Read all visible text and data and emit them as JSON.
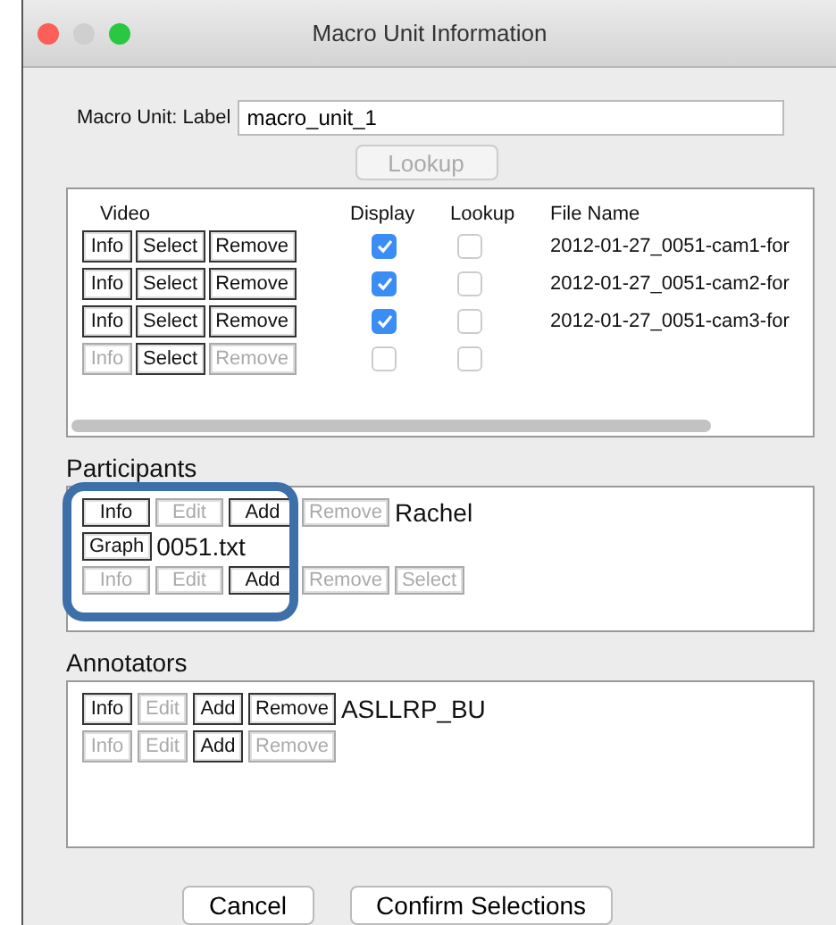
{
  "window": {
    "title": "Macro Unit Information"
  },
  "label_field": {
    "label": "Macro Unit: Label",
    "value": "macro_unit_1"
  },
  "lookup_button": {
    "label": "Lookup",
    "disabled": true
  },
  "video": {
    "columns": [
      "Video",
      "Display",
      "Lookup",
      "File Name"
    ],
    "rows": [
      {
        "buttons": [
          {
            "label": "Info",
            "disabled": false
          },
          {
            "label": "Select",
            "disabled": false
          },
          {
            "label": "Remove",
            "disabled": false
          }
        ],
        "display": {
          "checked": true
        },
        "lookup": {
          "checked": false
        },
        "file_name": "2012-01-27_0051-cam1-for"
      },
      {
        "buttons": [
          {
            "label": "Info",
            "disabled": false
          },
          {
            "label": "Select",
            "disabled": false
          },
          {
            "label": "Remove",
            "disabled": false
          }
        ],
        "display": {
          "checked": true
        },
        "lookup": {
          "checked": false
        },
        "file_name": "2012-01-27_0051-cam2-for"
      },
      {
        "buttons": [
          {
            "label": "Info",
            "disabled": false
          },
          {
            "label": "Select",
            "disabled": false
          },
          {
            "label": "Remove",
            "disabled": false
          }
        ],
        "display": {
          "checked": true
        },
        "lookup": {
          "checked": false
        },
        "file_name": "2012-01-27_0051-cam3-for"
      },
      {
        "buttons": [
          {
            "label": "Info",
            "disabled": true
          },
          {
            "label": "Select",
            "disabled": false
          },
          {
            "label": "Remove",
            "disabled": true
          }
        ],
        "display": {
          "checked": false
        },
        "lookup": {
          "checked": false
        }
      }
    ]
  },
  "participants": {
    "title": "Participants",
    "rows": [
      {
        "items": [
          {
            "kind": "button",
            "label": "Info",
            "disabled": false
          },
          {
            "kind": "button",
            "label": "Edit",
            "disabled": true
          },
          {
            "kind": "button",
            "label": "Add",
            "disabled": false
          },
          {
            "kind": "button",
            "label": "Remove",
            "disabled": true
          },
          {
            "kind": "text",
            "label": "Rachel"
          }
        ]
      },
      {
        "items": [
          {
            "kind": "button",
            "label": "Graph",
            "disabled": false
          },
          {
            "kind": "text",
            "label": "0051.txt"
          }
        ]
      },
      {
        "items": [
          {
            "kind": "button",
            "label": "Info",
            "disabled": true
          },
          {
            "kind": "button",
            "label": "Edit",
            "disabled": true
          },
          {
            "kind": "button",
            "label": "Add",
            "disabled": false
          },
          {
            "kind": "button",
            "label": "Remove",
            "disabled": true
          },
          {
            "kind": "button",
            "label": "Select",
            "disabled": true
          }
        ]
      }
    ]
  },
  "annotators": {
    "title": "Annotators",
    "rows": [
      {
        "items": [
          {
            "kind": "button",
            "label": "Info",
            "disabled": false
          },
          {
            "kind": "button",
            "label": "Edit",
            "disabled": true
          },
          {
            "kind": "button",
            "label": "Add",
            "disabled": false
          },
          {
            "kind": "button",
            "label": "Remove",
            "disabled": false
          },
          {
            "kind": "text",
            "label": "ASLLRP_BU"
          }
        ]
      },
      {
        "items": [
          {
            "kind": "button",
            "label": "Info",
            "disabled": true
          },
          {
            "kind": "button",
            "label": "Edit",
            "disabled": true
          },
          {
            "kind": "button",
            "label": "Add",
            "disabled": false
          },
          {
            "kind": "button",
            "label": "Remove",
            "disabled": true
          }
        ]
      }
    ]
  },
  "footer_buttons": [
    "Cancel",
    "Confirm Selections"
  ]
}
